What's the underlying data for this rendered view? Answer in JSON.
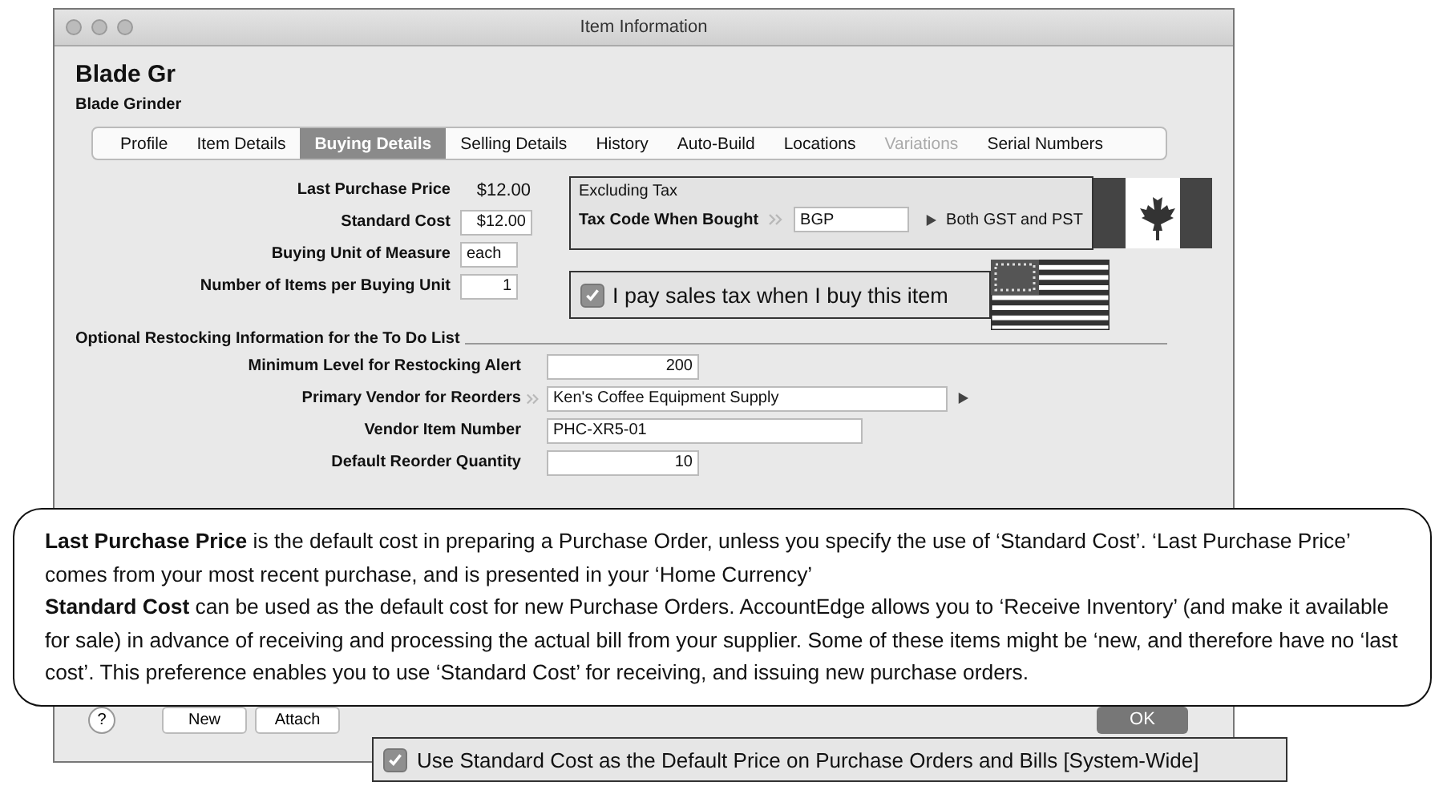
{
  "window": {
    "title": "Item Information"
  },
  "item": {
    "code": "Blade Gr",
    "name": "Blade Grinder"
  },
  "tabs": [
    {
      "label": "Profile",
      "selected": false,
      "disabled": false
    },
    {
      "label": "Item Details",
      "selected": false,
      "disabled": false
    },
    {
      "label": "Buying Details",
      "selected": true,
      "disabled": false
    },
    {
      "label": "Selling Details",
      "selected": false,
      "disabled": false
    },
    {
      "label": "History",
      "selected": false,
      "disabled": false
    },
    {
      "label": "Auto-Build",
      "selected": false,
      "disabled": false
    },
    {
      "label": "Locations",
      "selected": false,
      "disabled": false
    },
    {
      "label": "Variations",
      "selected": false,
      "disabled": true
    },
    {
      "label": "Serial Numbers",
      "selected": false,
      "disabled": false
    }
  ],
  "buying_fields": [
    {
      "label": "Last Purchase Price",
      "value": "$12.00",
      "kind": "readout"
    },
    {
      "label": "Standard Cost",
      "value": "$12.00",
      "kind": "number"
    },
    {
      "label": "Buying Unit of Measure",
      "value": "each",
      "kind": "text"
    },
    {
      "label": "Number of Items per Buying Unit",
      "value": "1",
      "kind": "number"
    }
  ],
  "tax_box": {
    "heading": "Excluding Tax",
    "code_label": "Tax Code When Bought",
    "code": "BGP",
    "description": "Both GST and PST"
  },
  "sales_tax": {
    "label": "I pay sales tax when I buy this item",
    "checked": true
  },
  "restocking": {
    "heading": "Optional Restocking Information for the To Do List",
    "fields": [
      {
        "label": "Minimum Level for Restocking Alert",
        "value": "200",
        "kind": "number"
      },
      {
        "label": "Primary Vendor for Reorders",
        "value": "Ken's Coffee Equipment Supply",
        "kind": "lookup"
      },
      {
        "label": "Vendor Item Number",
        "value": "PHC-XR5-01",
        "kind": "text"
      },
      {
        "label": "Default Reorder Quantity",
        "value": "10",
        "kind": "number"
      }
    ]
  },
  "callout": {
    "paragraphs": [
      "**Last Purchase Price** is the default cost in preparing a Purchase Order, unless you specify the use of ‘Standard Cost’. ‘Last Purchase Price’ comes from your most recent purchase, and is presented in your ‘Home Currency’",
      "**Standard Cost** can be used as the default cost for new Purchase Orders. AccountEdge allows you to ‘Receive Inventory’ (and make it available for sale) in advance of receiving and processing the actual bill from your supplier. Some of these items might be ‘new, and therefore have no ‘last cost’. This preference enables you to use ‘Standard Cost’ for receiving, and issuing new purchase orders."
    ]
  },
  "bottom_bar": {
    "help": "?",
    "buttons": [
      "New",
      "Attach"
    ],
    "ok": "OK"
  },
  "system_option": {
    "label": "Use Standard Cost as the Default Price on Purchase Orders and Bills [System-Wide]",
    "checked": true
  }
}
